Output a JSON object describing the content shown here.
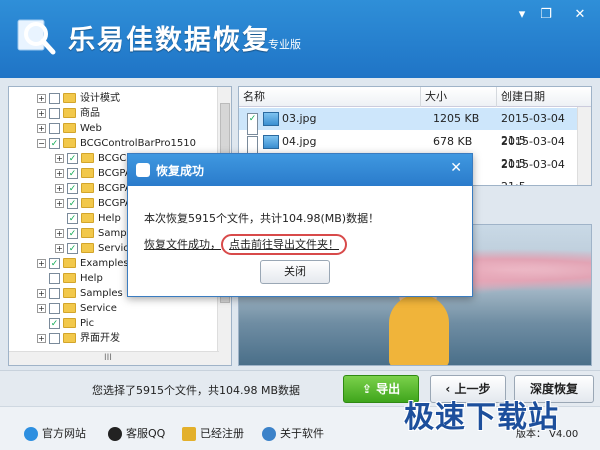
{
  "app": {
    "title": "乐易佳数据恢复",
    "edition": "专业版"
  },
  "window_controls": {
    "menu": "▾",
    "restore": "❐",
    "close": "✕"
  },
  "tree": {
    "rows": [
      {
        "label": "设计模式",
        "indent": 0,
        "expand": "+",
        "check": ""
      },
      {
        "label": "商品",
        "indent": 0,
        "expand": "+",
        "check": ""
      },
      {
        "label": "Web",
        "indent": 0,
        "expand": "+",
        "check": ""
      },
      {
        "label": "BCGControlBarPro1510",
        "indent": 0,
        "expand": "−",
        "check": "✓"
      },
      {
        "label": "BCGCBPro",
        "indent": 1,
        "expand": "+",
        "check": "✓"
      },
      {
        "label": "BCGPA",
        "indent": 1,
        "expand": "+",
        "check": "✓"
      },
      {
        "label": "BCGPA",
        "indent": 1,
        "expand": "+",
        "check": "✓"
      },
      {
        "label": "BCGPA",
        "indent": 1,
        "expand": "+",
        "check": "✓"
      },
      {
        "label": "Help",
        "indent": 1,
        "expand": "",
        "check": "✓"
      },
      {
        "label": "Sample",
        "indent": 1,
        "expand": "+",
        "check": "✓"
      },
      {
        "label": "Service",
        "indent": 1,
        "expand": "+",
        "check": "✓"
      },
      {
        "label": "Examples",
        "indent": 0,
        "expand": "+",
        "check": "✓"
      },
      {
        "label": "Help",
        "indent": 0,
        "expand": "",
        "check": ""
      },
      {
        "label": "Samples",
        "indent": 0,
        "expand": "+",
        "check": ""
      },
      {
        "label": "Service",
        "indent": 0,
        "expand": "+",
        "check": ""
      },
      {
        "label": "Pic",
        "indent": 0,
        "expand": "",
        "check": "✓"
      },
      {
        "label": "界面开发",
        "indent": 0,
        "expand": "+",
        "check": ""
      }
    ],
    "h_scroll_grip": "III"
  },
  "file_list": {
    "columns": {
      "name": "名称",
      "size": "大小",
      "date": "创建日期"
    },
    "rows": [
      {
        "check": "✓",
        "name": "03.jpg",
        "size": "1205 KB",
        "date": "2015-03-04 21:5"
      },
      {
        "check": "",
        "name": "04.jpg",
        "size": "678 KB",
        "date": "2015-03-04 21:5"
      },
      {
        "check": "",
        "name": "",
        "size": "",
        "date": "2015-03-04 21:5"
      }
    ]
  },
  "dialog": {
    "title": "恢复成功",
    "close": "✕",
    "message": "本次恢复5915个文件，共计104.98(MB)数据！",
    "status_text": "恢复文件成功，",
    "link_text": "点击前往导出文件夹！",
    "button": "关闭"
  },
  "bottom": {
    "selected_info": "您选择了5915个文件，共104.98 MB数据",
    "export": "导出",
    "prev": "上一步",
    "deep": "深度恢复"
  },
  "status": {
    "website": "官方网站",
    "qq": "客服QQ",
    "registered": "已经注册",
    "about": "关于软件",
    "version": "版本： V4.00"
  },
  "watermark": "极速下载站",
  "colors": {
    "accent": "#2a7bcb",
    "export_green": "#3fa51c",
    "link_circle": "#d84a4a"
  }
}
